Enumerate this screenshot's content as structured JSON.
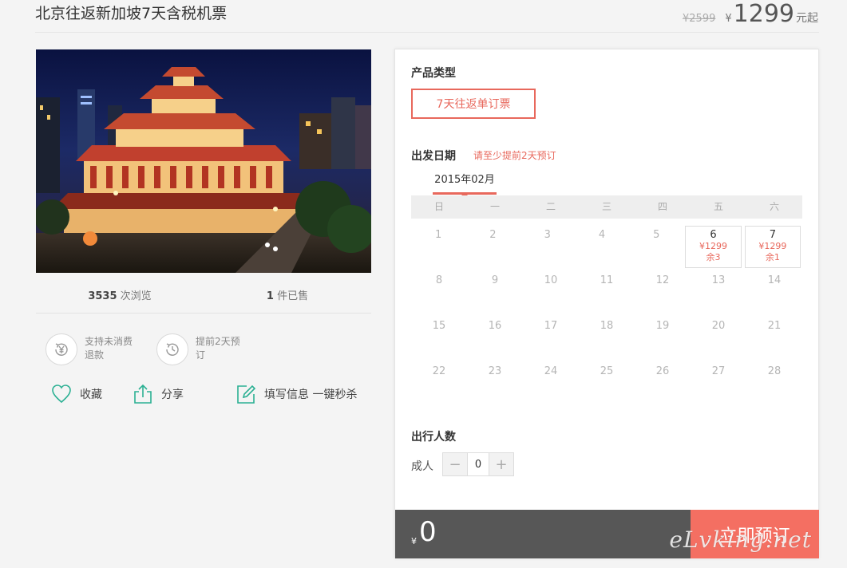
{
  "header": {
    "title": "北京往返新加坡7天含税机票",
    "original_price": "¥2599",
    "currency": "¥",
    "price": "1299",
    "price_suffix": "元起"
  },
  "stats": {
    "views_count": "3535",
    "views_label": "次浏览",
    "sold_count": "1",
    "sold_label": "件已售"
  },
  "features": [
    {
      "icon": "yen-refund-icon",
      "text": "支持未消费退款"
    },
    {
      "icon": "clock-icon",
      "text": "提前2天预订"
    }
  ],
  "actions": {
    "favorite": "收藏",
    "share": "分享",
    "quick_buy": "填写信息 一键秒杀"
  },
  "booking": {
    "product_type_label": "产品类型",
    "product_type_option": "7天往返单订票",
    "date_label": "出发日期",
    "date_hint": "请至少提前2天预订",
    "month": "2015年02月",
    "weekdays": [
      "日",
      "一",
      "二",
      "三",
      "四",
      "五",
      "六"
    ],
    "weeks": [
      [
        {
          "d": "1"
        },
        {
          "d": "2"
        },
        {
          "d": "3"
        },
        {
          "d": "4"
        },
        {
          "d": "5"
        },
        {
          "d": "6",
          "price": "¥1299",
          "remain": "余3"
        },
        {
          "d": "7",
          "price": "¥1299",
          "remain": "余1"
        }
      ],
      [
        {
          "d": "8"
        },
        {
          "d": "9"
        },
        {
          "d": "10"
        },
        {
          "d": "11"
        },
        {
          "d": "12"
        },
        {
          "d": "13"
        },
        {
          "d": "14"
        }
      ],
      [
        {
          "d": "15"
        },
        {
          "d": "16"
        },
        {
          "d": "17"
        },
        {
          "d": "18"
        },
        {
          "d": "19"
        },
        {
          "d": "20"
        },
        {
          "d": "21"
        }
      ],
      [
        {
          "d": "22"
        },
        {
          "d": "23"
        },
        {
          "d": "24"
        },
        {
          "d": "25"
        },
        {
          "d": "26"
        },
        {
          "d": "27"
        },
        {
          "d": "28"
        }
      ]
    ],
    "travelers_label": "出行人数",
    "adult_label": "成人",
    "minus": "−",
    "plus": "+",
    "adult_count": "0",
    "total_currency": "¥",
    "total": "0",
    "book_button": "立即预订",
    "accent_color": "#e8685c"
  },
  "watermark": "eLvking.net"
}
